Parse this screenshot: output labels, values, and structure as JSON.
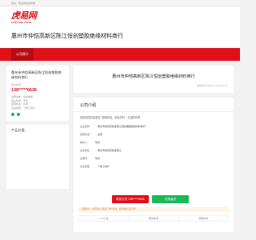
{
  "topbar": {
    "text": "您好，欢迎来到虎易网"
  },
  "logo": {
    "main": "虎易网",
    "sub": "cnhrzp.com"
  },
  "company": {
    "title": "惠州市仲恺高新区陈江恒创塑胶绝缘材料商行"
  },
  "nav": {
    "active": "公司简介"
  },
  "sidebar": {
    "name": "惠州市仲恺高新区陈江恒创塑胶绝缘材料商行",
    "phone_label": "联系电话",
    "phone": "138*****6636",
    "info": [
      "注册资本：企业参考",
      "成立时间：暂无",
      "经营状态：在营",
      "企业类型：个体工商户"
    ],
    "products_title": "产品分类"
  },
  "main": {
    "card_title": "惠州市仲恺高新区陈江恒创塑胶绝缘材料商行",
    "meta": "发布时间 2023-05-15 07:12:33",
    "section_title": "公司介绍",
    "intro": "经营范围包括零售: 塑胶制品、绝缘材料、五金配件等",
    "kv": [
      {
        "k": "企业名称",
        "v": "惠州市仲恺高新区陈江恒创塑胶绝缘材料商行"
      },
      {
        "k": "经营状态",
        "v": "在营"
      },
      {
        "k": "联系人",
        "v": "暂无"
      },
      {
        "k": "企业地址",
        "v": "惠州市仲恺高新区陈江"
      },
      {
        "k": "注册号",
        "v": "暂无"
      },
      {
        "k": "企业类型",
        "v": "个体工商户"
      }
    ],
    "btn_phone": "联系方式 138*****6636",
    "btn_wechat": "在线留言",
    "tips": "温馨提示：本页面信息来源于用户提交，请谨慎核实后合作",
    "bottom": [
      "个人认证",
      "服务承诺",
      "客服热线"
    ]
  }
}
